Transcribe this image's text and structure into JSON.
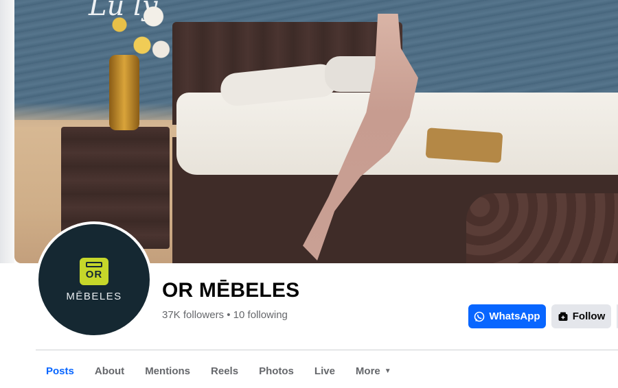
{
  "page": {
    "name": "OR MĒBELES",
    "followers": "37K",
    "followers_label": "followers",
    "separator": "•",
    "following": "10",
    "following_label": "following"
  },
  "avatar": {
    "logo_mark": "OR",
    "logo_text": "MĒBELES",
    "colors": {
      "background": "#152832",
      "accent": "#c6d72a"
    }
  },
  "actions": {
    "whatsapp_label": "WhatsApp",
    "follow_label": "Follow",
    "whatsapp_icon": "whatsapp-icon",
    "follow_icon": "follow-icon"
  },
  "tabs": [
    {
      "label": "Posts",
      "active": true
    },
    {
      "label": "About"
    },
    {
      "label": "Mentions"
    },
    {
      "label": "Reels"
    },
    {
      "label": "Photos"
    },
    {
      "label": "Live"
    },
    {
      "label": "More",
      "icon": "caret-down-icon"
    }
  ],
  "colors": {
    "primary": "#0866ff",
    "secondary_bg": "#e4e6eb",
    "muted_text": "#65676b"
  }
}
